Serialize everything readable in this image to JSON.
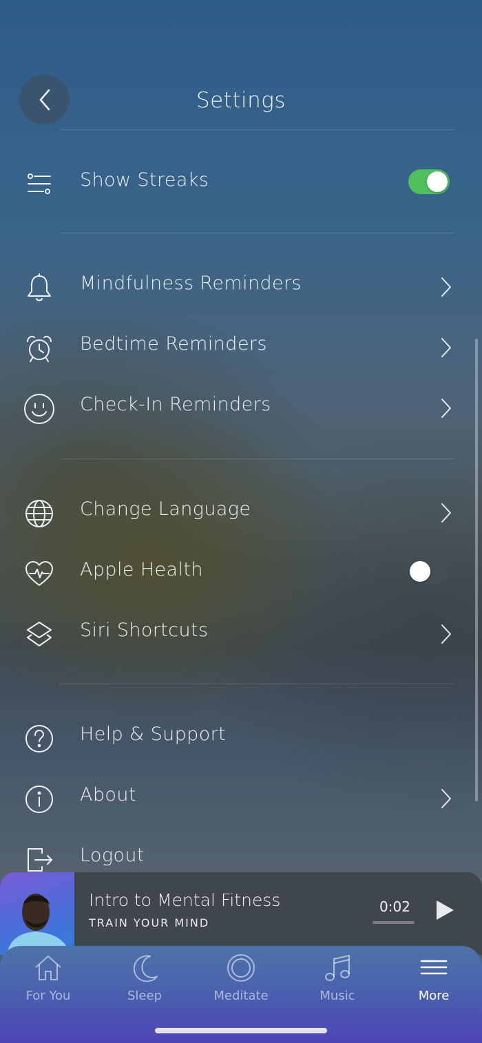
{
  "header": {
    "title": "Settings",
    "back_icon": "chevron-left-icon"
  },
  "streaks": {
    "label": "Show Streaks",
    "icon": "sliders-icon",
    "enabled": true,
    "accent": "#4fc05a"
  },
  "reminders": [
    {
      "label": "Mindfulness Reminders",
      "icon": "bell-icon"
    },
    {
      "label": "Bedtime Reminders",
      "icon": "alarm-clock-icon"
    },
    {
      "label": "Check-In Reminders",
      "icon": "smiley-icon"
    }
  ],
  "preferences": [
    {
      "label": "Change Language",
      "icon": "globe-icon"
    },
    {
      "label": "Apple Health",
      "icon": "heart-pulse-icon",
      "enabled": false
    },
    {
      "label": "Siri Shortcuts",
      "icon": "shortcuts-icon"
    }
  ],
  "support": [
    {
      "label": "Help & Support",
      "icon": "question-icon"
    },
    {
      "label": "About",
      "icon": "info-icon"
    },
    {
      "label": "Logout",
      "icon": "logout-icon"
    }
  ],
  "player": {
    "title": "Intro to Mental Fitness",
    "subtitle": "TRAIN YOUR MIND",
    "time": "0:02",
    "play_icon": "play-icon"
  },
  "tabs": [
    {
      "label": "For You",
      "icon": "home-icon",
      "active": false
    },
    {
      "label": "Sleep",
      "icon": "moon-icon",
      "active": false
    },
    {
      "label": "Meditate",
      "icon": "ring-icon",
      "active": false
    },
    {
      "label": "Music",
      "icon": "music-note-icon",
      "active": false
    },
    {
      "label": "More",
      "icon": "menu-icon",
      "active": true
    }
  ]
}
